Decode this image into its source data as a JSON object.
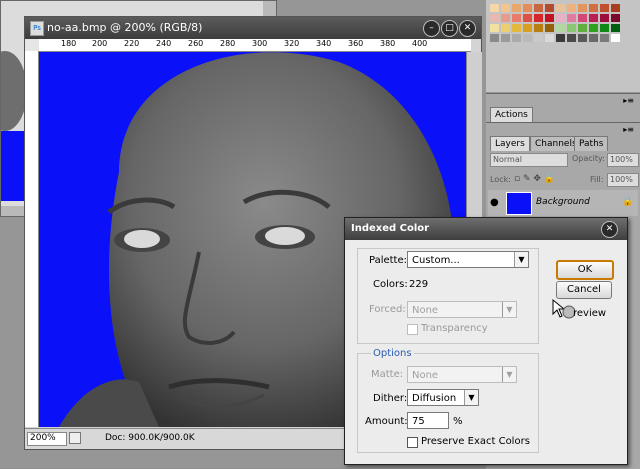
{
  "document": {
    "title": "no-aa.bmp @ 200% (RGB/8)",
    "ruler_ticks": [
      "180",
      "200",
      "220",
      "240",
      "260",
      "280",
      "300",
      "320",
      "340",
      "360",
      "380",
      "400"
    ],
    "zoom": "200%",
    "doc_info": "Doc: 900.0K/900.0K",
    "canvas_color": "#0a10f8"
  },
  "palettes": {
    "actions_tab": "Actions",
    "layers_tabs": [
      "Layers",
      "Channels",
      "Paths"
    ],
    "blend_mode": "Normal",
    "opacity_label": "Opacity:",
    "opacity_value": "100%",
    "lock_label": "Lock:",
    "fill_label": "Fill:",
    "fill_value": "100%",
    "layer_name": "Background"
  },
  "swatch_colors": [
    "#f5d7a8",
    "#f3c48d",
    "#e8a86c",
    "#e38d5b",
    "#c9663f",
    "#b44a2e",
    "#e8c39a",
    "#f0b07c",
    "#e2955c",
    "#d07040",
    "#c0502c",
    "#a83d20",
    "#e7b9b0",
    "#e89a8c",
    "#e97b6b",
    "#df4f45",
    "#d8242c",
    "#c01222",
    "#e8b0c4",
    "#e07aa0",
    "#d44878",
    "#b81f52",
    "#9d0d3e",
    "#7a0a2c",
    "#f2e0a0",
    "#ecd070",
    "#e3b83c",
    "#d8a020",
    "#b87e10",
    "#946008",
    "#b0d8a0",
    "#88c870",
    "#60b040",
    "#30a020",
    "#108818",
    "#006010",
    "#8a8a8a",
    "#9a9a9a",
    "#aaaaaa",
    "#bababa",
    "#cacaca",
    "#dadada",
    "#3a3a3a",
    "#4a4a4a",
    "#5a5a5a",
    "#6a6a6a",
    "#7a7a7a",
    "#ffffff"
  ],
  "dialog": {
    "title": "Indexed Color",
    "palette_label": "Palette:",
    "palette_value": "Custom...",
    "colors_label": "Colors:",
    "colors_value": "229",
    "forced_label": "Forced:",
    "forced_value": "None",
    "transparency_label": "Transparency",
    "options_heading": "Options",
    "matte_label": "Matte:",
    "matte_value": "None",
    "dither_label": "Dither:",
    "dither_value": "Diffusion",
    "amount_label": "Amount:",
    "amount_value": "75",
    "amount_unit": "%",
    "preserve_label": "Preserve Exact Colors",
    "ok_label": "OK",
    "cancel_label": "Cancel",
    "preview_label": "review"
  }
}
